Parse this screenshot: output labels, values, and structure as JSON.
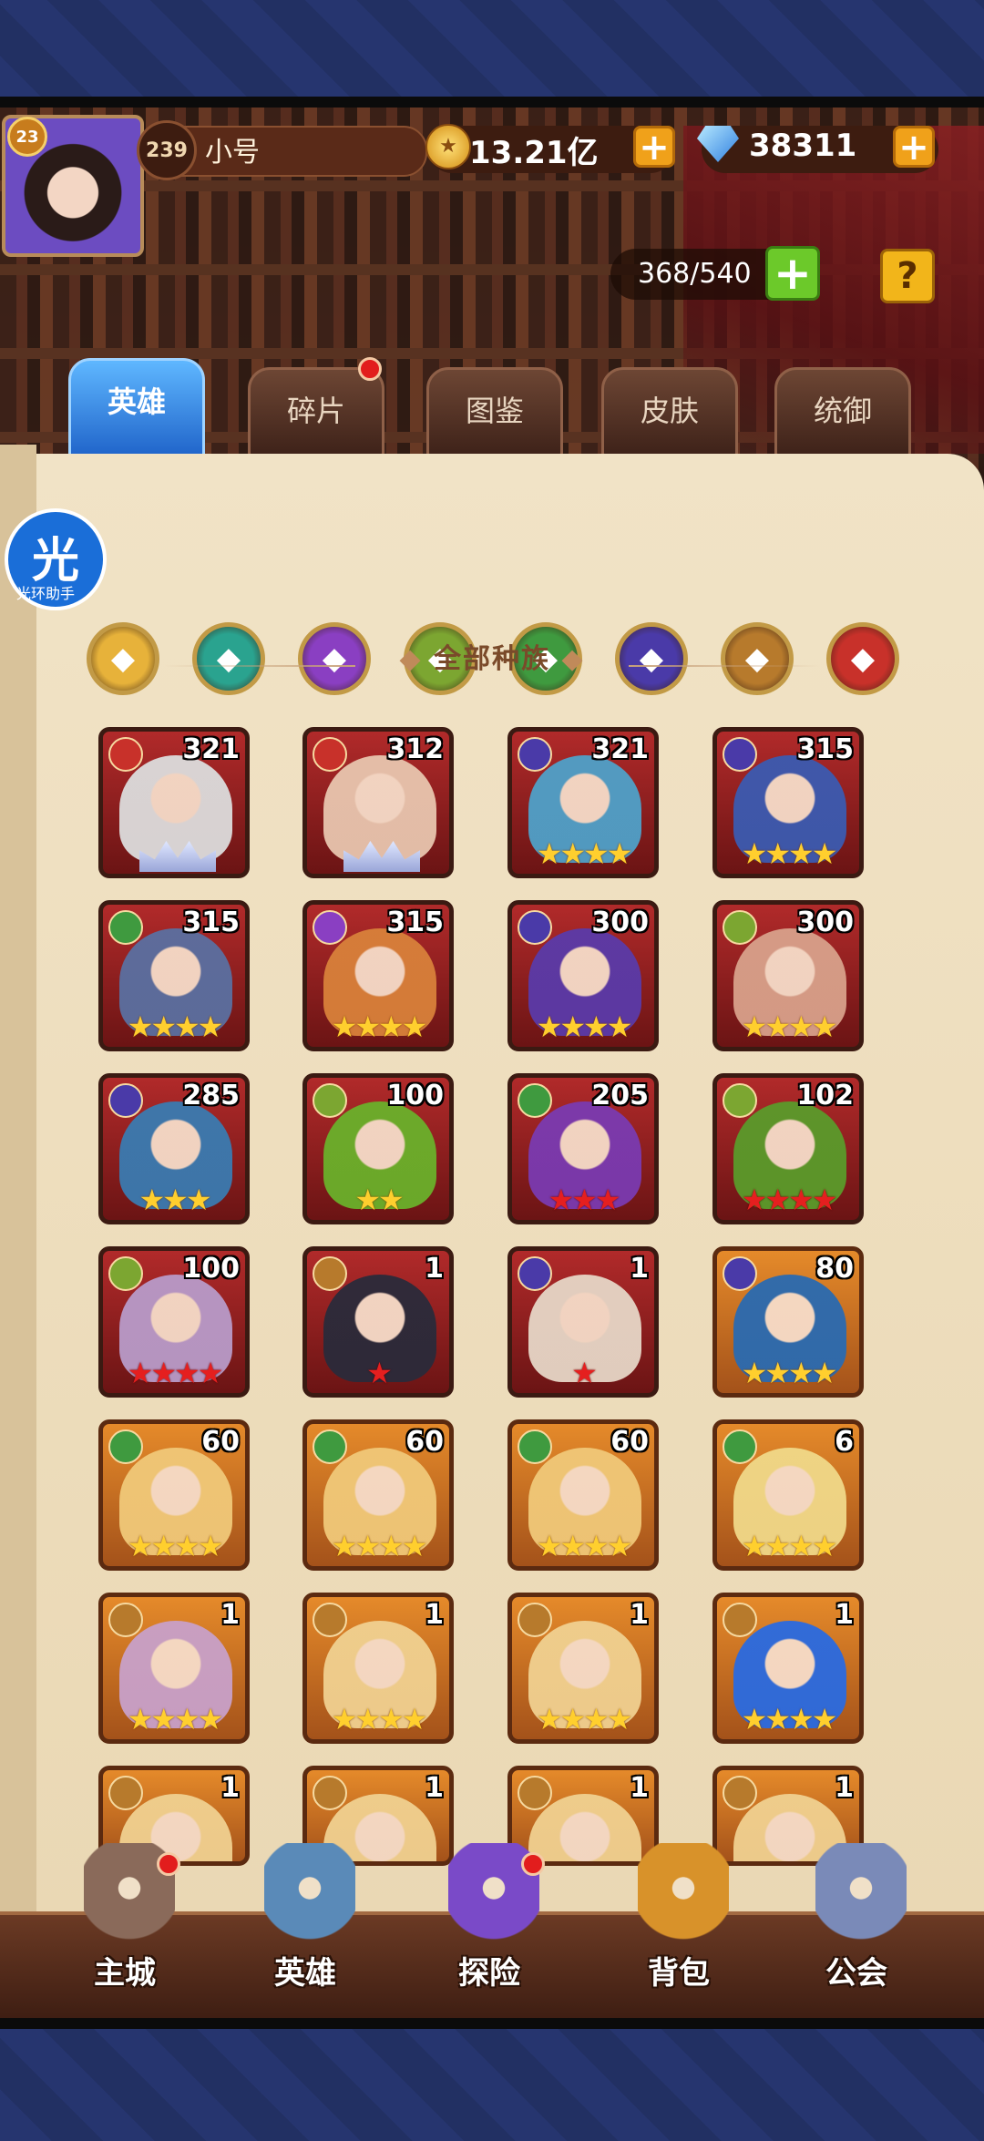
{
  "player": {
    "level": "23",
    "vip": "239",
    "name": "小号"
  },
  "currency": {
    "gold": "13.21亿",
    "gems": "38311"
  },
  "hero_capacity": "368/540",
  "help_label": "?",
  "plus_label": "+",
  "tabs": [
    {
      "label": "英雄",
      "active": true
    },
    {
      "label": "碎片",
      "badge": true
    },
    {
      "label": "图鉴"
    },
    {
      "label": "皮肤"
    },
    {
      "label": "统御"
    }
  ],
  "helper_overlay": {
    "glyph": "光",
    "label": "光环助手"
  },
  "filter_section_title": "全部种族",
  "race_filters": [
    {
      "name": "all",
      "color": "#e7b23a"
    },
    {
      "name": "forest",
      "color": "#2aa38f"
    },
    {
      "name": "shadow",
      "color": "#8a3fc2"
    },
    {
      "name": "nature",
      "color": "#7ca631"
    },
    {
      "name": "elf",
      "color": "#3f9a3f"
    },
    {
      "name": "undead",
      "color": "#4a3aa8"
    },
    {
      "name": "light",
      "color": "#b77a2c"
    },
    {
      "name": "demon",
      "color": "#c8312a"
    }
  ],
  "heroes": [
    {
      "level": "321",
      "race": "#c8312a",
      "stars": 0,
      "star_color": "crown",
      "frame": "red",
      "tint": "#dcdcdc"
    },
    {
      "level": "312",
      "race": "#c8312a",
      "stars": 0,
      "star_color": "crown",
      "frame": "red",
      "tint": "#e8c5ae"
    },
    {
      "level": "321",
      "race": "#4a3aa8",
      "stars": 4,
      "star_color": "gold",
      "frame": "red",
      "tint": "#4fa0c8"
    },
    {
      "level": "315",
      "race": "#4a3aa8",
      "stars": 4,
      "star_color": "gold",
      "frame": "red",
      "tint": "#3b5ab0"
    },
    {
      "level": "315",
      "race": "#3f9a3f",
      "stars": 4,
      "star_color": "gold",
      "frame": "red",
      "tint": "#5a6fa0"
    },
    {
      "level": "315",
      "race": "#8a3fc2",
      "stars": 4,
      "star_color": "gold",
      "frame": "red",
      "tint": "#d8803a"
    },
    {
      "level": "300",
      "race": "#4a3aa8",
      "stars": 4,
      "star_color": "gold",
      "frame": "red",
      "tint": "#5a3aa8"
    },
    {
      "level": "300",
      "race": "#7ca631",
      "stars": 4,
      "star_color": "gold",
      "frame": "red",
      "tint": "#d8a08a"
    },
    {
      "level": "285",
      "race": "#4a3aa8",
      "stars": 3,
      "star_color": "gold",
      "frame": "red",
      "tint": "#3a7ab0"
    },
    {
      "level": "100",
      "race": "#7ca631",
      "stars": 2,
      "star_color": "gold",
      "frame": "red",
      "tint": "#6ab02a"
    },
    {
      "level": "205",
      "race": "#3f9a3f",
      "stars": 3,
      "star_color": "red",
      "frame": "red",
      "tint": "#7a3ab0"
    },
    {
      "level": "102",
      "race": "#7ca631",
      "stars": 4,
      "star_color": "red",
      "frame": "red",
      "tint": "#5a9a2a"
    },
    {
      "level": "100",
      "race": "#7ca631",
      "stars": 4,
      "star_color": "red",
      "frame": "red",
      "tint": "#b89ac8"
    },
    {
      "level": "1",
      "race": "#b77a2c",
      "stars": 1,
      "star_color": "red",
      "frame": "red",
      "tint": "#2a2a3a"
    },
    {
      "level": "1",
      "race": "#4a3aa8",
      "stars": 1,
      "star_color": "red",
      "frame": "red",
      "tint": "#e6d6c6"
    },
    {
      "level": "80",
      "race": "#4a3aa8",
      "stars": 4,
      "star_color": "gold",
      "frame": "orange",
      "tint": "#2a6ab0"
    },
    {
      "level": "60",
      "race": "#3f9a3f",
      "stars": 4,
      "star_color": "gold",
      "frame": "orange",
      "tint": "#f0c878"
    },
    {
      "level": "60",
      "race": "#3f9a3f",
      "stars": 4,
      "star_color": "gold",
      "frame": "orange",
      "tint": "#f0c878"
    },
    {
      "level": "60",
      "race": "#3f9a3f",
      "stars": 4,
      "star_color": "gold",
      "frame": "orange",
      "tint": "#f0c878"
    },
    {
      "level": "6",
      "race": "#3f9a3f",
      "stars": 4,
      "star_color": "gold",
      "frame": "orange",
      "tint": "#f0d888"
    },
    {
      "level": "1",
      "race": "#b77a2c",
      "stars": 4,
      "star_color": "gold",
      "frame": "orange",
      "tint": "#c8a0c8"
    },
    {
      "level": "1",
      "race": "#b77a2c",
      "stars": 4,
      "star_color": "gold",
      "frame": "orange",
      "tint": "#f0d090"
    },
    {
      "level": "1",
      "race": "#b77a2c",
      "stars": 4,
      "star_color": "gold",
      "frame": "orange",
      "tint": "#f0d090"
    },
    {
      "level": "1",
      "race": "#b77a2c",
      "stars": 4,
      "star_color": "gold",
      "frame": "orange",
      "tint": "#2a6ae0"
    },
    {
      "level": "1",
      "race": "#b77a2c",
      "stars": 0,
      "star_color": "gold",
      "frame": "orange",
      "tint": "#f0d090"
    },
    {
      "level": "1",
      "race": "#b77a2c",
      "stars": 0,
      "star_color": "gold",
      "frame": "orange",
      "tint": "#f0d090"
    },
    {
      "level": "1",
      "race": "#b77a2c",
      "stars": 0,
      "star_color": "gold",
      "frame": "orange",
      "tint": "#f0d090"
    },
    {
      "level": "1",
      "race": "#b77a2c",
      "stars": 0,
      "star_color": "gold",
      "frame": "orange",
      "tint": "#f0d090"
    }
  ],
  "bottom_nav": [
    {
      "label": "主城",
      "icon": "castle-icon",
      "badge": true
    },
    {
      "label": "英雄",
      "icon": "hero-icon",
      "badge": false
    },
    {
      "label": "探险",
      "icon": "portal-icon",
      "badge": true
    },
    {
      "label": "背包",
      "icon": "backpack-icon",
      "badge": false
    },
    {
      "label": "公会",
      "icon": "guild-icon",
      "badge": false
    }
  ]
}
